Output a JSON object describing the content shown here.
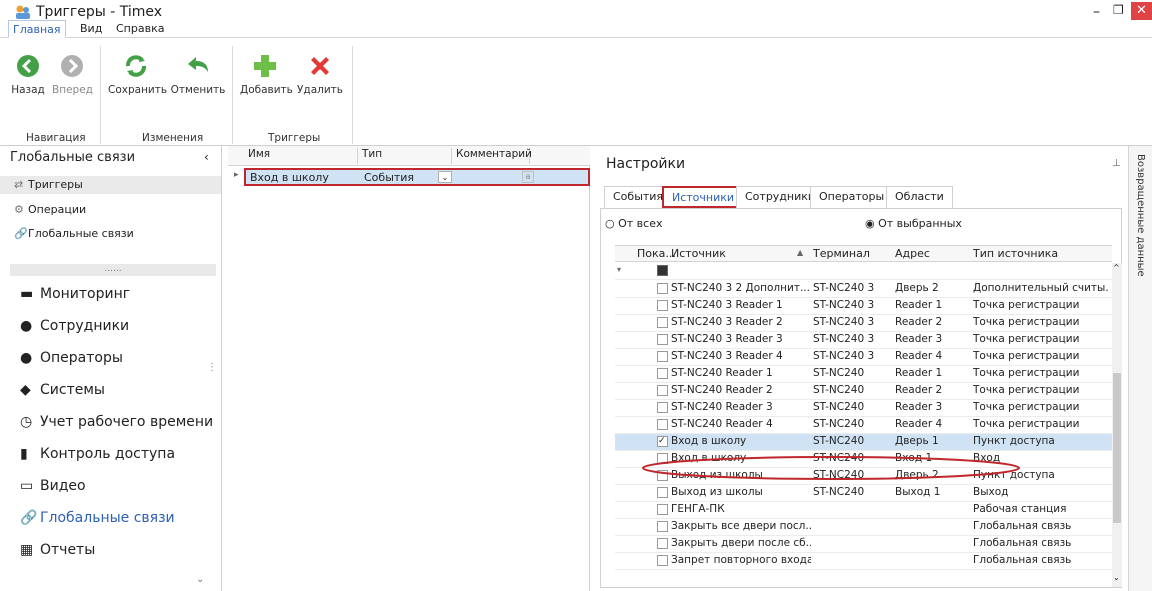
{
  "window": {
    "title": "Триггеры - Timex"
  },
  "menu": {
    "tabs": [
      "Главная",
      "Вид",
      "Справка"
    ]
  },
  "ribbon": {
    "navigation": {
      "back": "Назад",
      "forward": "Вперед",
      "group": "Навигация"
    },
    "changes": {
      "save": "Сохранить",
      "cancel": "Отменить",
      "group": "Изменения"
    },
    "triggers": {
      "add": "Добавить",
      "delete": "Удалить",
      "group": "Триггеры"
    }
  },
  "left": {
    "title": "Глобальные связи",
    "items": [
      "Триггеры",
      "Операции",
      "Глобальные связи"
    ],
    "nav": [
      "Мониторинг",
      "Сотрудники",
      "Операторы",
      "Системы",
      "Учет рабочего времени",
      "Контроль доступа",
      "Видео",
      "Глобальные связи",
      "Отчеты"
    ]
  },
  "triggers_grid": {
    "headers": [
      "Имя",
      "Тип",
      "Комментарий"
    ],
    "row": {
      "name": "Вход в школу",
      "type": "События"
    }
  },
  "settings": {
    "title": "Настройки",
    "tabs": [
      "События",
      "Источники",
      "Сотрудники",
      "Операторы",
      "Области"
    ],
    "radio_all": "От всех",
    "radio_selected": "От выбранных",
    "headers": [
      "Пока...",
      "Источник",
      "Терминал",
      "Адрес",
      "Тип источника"
    ],
    "rows": [
      {
        "source": "ST-NC240 3 2 Дополнит...",
        "terminal": "ST-NC240 3",
        "address": "Дверь 2",
        "type": "Дополнительный считы..."
      },
      {
        "source": "ST-NC240 3 Reader 1",
        "terminal": "ST-NC240 3",
        "address": "Reader 1",
        "type": "Точка регистрации"
      },
      {
        "source": "ST-NC240 3 Reader 2",
        "terminal": "ST-NC240 3",
        "address": "Reader 2",
        "type": "Точка регистрации"
      },
      {
        "source": "ST-NC240 3 Reader 3",
        "terminal": "ST-NC240 3",
        "address": "Reader 3",
        "type": "Точка регистрации"
      },
      {
        "source": "ST-NC240 3 Reader 4",
        "terminal": "ST-NC240 3",
        "address": "Reader 4",
        "type": "Точка регистрации"
      },
      {
        "source": "ST-NC240 Reader 1",
        "terminal": "ST-NC240",
        "address": "Reader 1",
        "type": "Точка регистрации"
      },
      {
        "source": "ST-NC240 Reader 2",
        "terminal": "ST-NC240",
        "address": "Reader 2",
        "type": "Точка регистрации"
      },
      {
        "source": "ST-NC240 Reader 3",
        "terminal": "ST-NC240",
        "address": "Reader 3",
        "type": "Точка регистрации"
      },
      {
        "source": "ST-NC240 Reader 4",
        "terminal": "ST-NC240",
        "address": "Reader 4",
        "type": "Точка регистрации"
      },
      {
        "source": "Вход в школу",
        "terminal": "ST-NC240",
        "address": "Дверь 1",
        "type": "Пункт доступа"
      },
      {
        "source": "Вход в школу",
        "terminal": "ST-NC240",
        "address": "Вход 1",
        "type": "Вход"
      },
      {
        "source": "Выход из школы",
        "terminal": "ST-NC240",
        "address": "Дверь 2",
        "type": "Пункт доступа"
      },
      {
        "source": "Выход из школы",
        "terminal": "ST-NC240",
        "address": "Выход 1",
        "type": "Выход"
      },
      {
        "source": "ГЕНГА-ПК",
        "terminal": "",
        "address": "",
        "type": "Рабочая станция"
      },
      {
        "source": "Закрыть все двери посл...",
        "terminal": "",
        "address": "",
        "type": "Глобальная связь"
      },
      {
        "source": "Закрыть двери после сб...",
        "terminal": "",
        "address": "",
        "type": "Глобальная связь"
      },
      {
        "source": "Запрет повторного входа",
        "terminal": "",
        "address": "",
        "type": "Глобальная связь"
      }
    ]
  },
  "sidebar_vertical": "Возвращенные данные",
  "colors": {
    "accent": "#2d61b5",
    "selected_row": "#cfe3f5",
    "highlight_red": "#c0272d"
  }
}
